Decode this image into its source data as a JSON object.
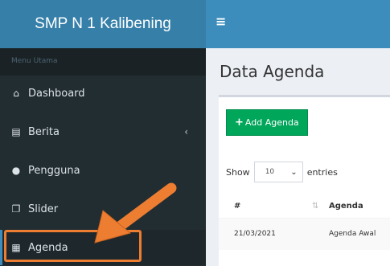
{
  "brand": {
    "title": "SMP N 1 Kalibening"
  },
  "topbar": {
    "menu_icon": "≡"
  },
  "sidebar": {
    "header": "Menu Utama",
    "items": [
      {
        "label": "Dashboard",
        "icon": "home-icon"
      },
      {
        "label": "Berita",
        "icon": "newspaper-icon",
        "has_submenu": true
      },
      {
        "label": "Pengguna",
        "icon": "users-icon"
      },
      {
        "label": "Slider",
        "icon": "clone-icon"
      },
      {
        "label": "Agenda",
        "icon": "calendar-icon",
        "active": true
      }
    ]
  },
  "main": {
    "title": "Data Agenda",
    "add_button": "Add Agenda",
    "show_label": "Show",
    "entries_value": "10",
    "entries_label": "entries",
    "table": {
      "columns": [
        "#",
        "Agenda"
      ],
      "rows": [
        {
          "date": "21/03/2021",
          "agenda": "Agenda Awal"
        }
      ]
    }
  },
  "annotation": {
    "color": "#ed7d31"
  }
}
